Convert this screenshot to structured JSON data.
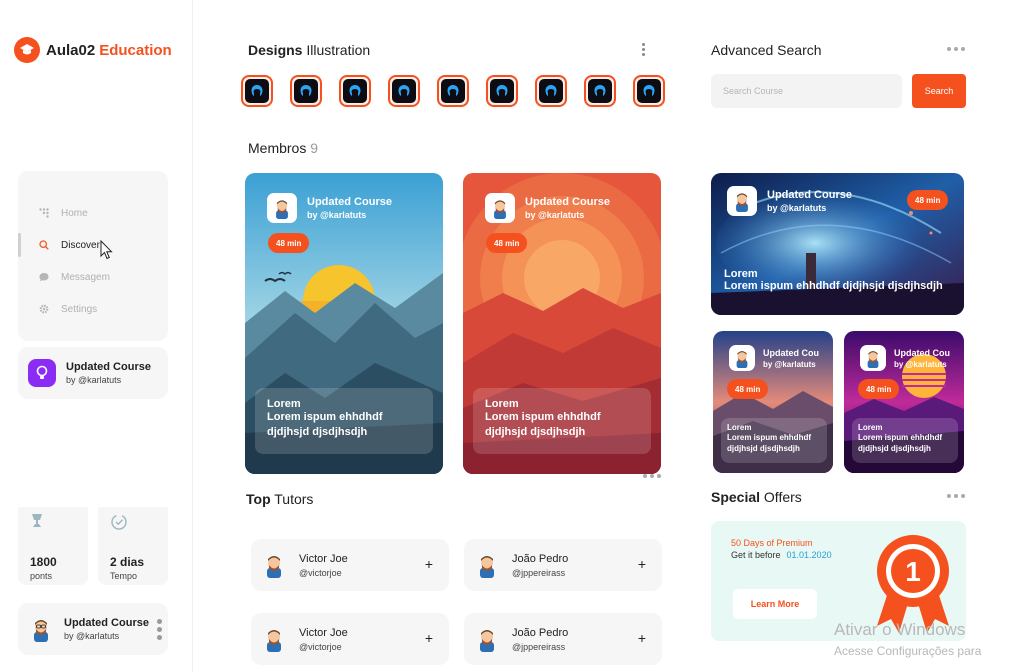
{
  "app": {
    "brand": "Aula02",
    "brand_accent": "Education",
    "accent_color": "#f4511e"
  },
  "sidebar": {
    "menu": [
      {
        "label": "Home",
        "icon": "grid-icon"
      },
      {
        "label": "Discover",
        "icon": "search-icon",
        "active": true
      },
      {
        "label": "Messagem",
        "icon": "chat-icon"
      },
      {
        "label": "Settings",
        "icon": "gear-icon"
      }
    ],
    "course_card": {
      "title": "Updated Course",
      "author": "by @karlatuts"
    },
    "stats": [
      {
        "value": "1800",
        "label": "ponts",
        "icon": "trophy-icon"
      },
      {
        "value": "2 dias",
        "label": "Tempo",
        "icon": "clock-check-icon"
      }
    ],
    "profile_card": {
      "title": "Updated Course",
      "author": "by @karlatuts"
    }
  },
  "designs": {
    "title_bold": "Designs",
    "title_rest": "Illustration",
    "avatar_count": 9
  },
  "members": {
    "title": "Membros",
    "count": "9",
    "cards": [
      {
        "title": "Updated Course",
        "author": "by @karlatuts",
        "duration": "48 min",
        "heading": "Lorem",
        "text": "Lorem ispum ehhdhdf djdjhsjd djsdjhsdjh"
      },
      {
        "title": "Updated Course",
        "author": "by @karlatuts",
        "duration": "48 min",
        "heading": "Lorem",
        "text": "Lorem ispum ehhdhdf djdjhsjd djsdjhsdjh"
      }
    ]
  },
  "top_tutors": {
    "title_bold": "Top",
    "title_rest": "Tutors",
    "tutors": [
      {
        "name": "Victor Joe",
        "handle": "@victorjoe"
      },
      {
        "name": "João Pedro",
        "handle": "@jppereirass"
      },
      {
        "name": "Victor Joe",
        "handle": "@victorjoe"
      },
      {
        "name": "João Pedro",
        "handle": "@jppereirass"
      }
    ],
    "add_symbol": "+"
  },
  "advanced_search": {
    "title_bold": "Advanced",
    "title_rest": "Search",
    "placeholder": "Search Course",
    "button": "Search"
  },
  "featured": {
    "large": {
      "title": "Updated Course",
      "author": "by @karlatuts",
      "duration": "48 min",
      "heading": "Lorem",
      "text": "Lorem ispum ehhdhdf djdjhsjd djsdjhsdjh"
    },
    "small": [
      {
        "title": "Updated Cou",
        "author": "by @karlatuts",
        "duration": "48 min",
        "heading": "Lorem",
        "text": "Lorem ispum ehhdhdf djdjhsjd djsdjhsdjh"
      },
      {
        "title": "Updated Cou",
        "author": "by @karlatuts",
        "duration": "48 min",
        "heading": "Lorem",
        "text": "Lorem ispum ehhdhdf djdjhsjd djsdjhsdjh"
      }
    ]
  },
  "special_offers": {
    "title_bold": "Special",
    "title_rest": "Offers",
    "promo": "50 Days of Premium",
    "get_label": "Get it before",
    "date": "01.01.2020",
    "button": "Learn More",
    "badge_number": "1"
  },
  "watermark": {
    "line1": "Ativar o Windows",
    "line2": "Acesse Configurações para"
  }
}
